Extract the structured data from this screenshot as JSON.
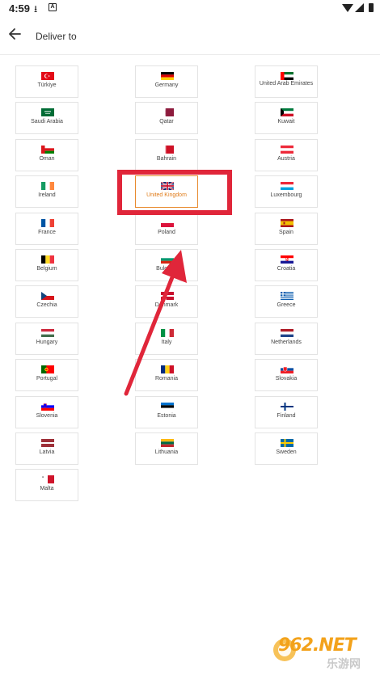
{
  "status_bar": {
    "time": "4:59"
  },
  "header": {
    "title": "Deliver to"
  },
  "countries": [
    {
      "name": "Türkiye",
      "flag": "turkey"
    },
    {
      "name": "Germany",
      "flag": "germany"
    },
    {
      "name": "United Arab Emirates",
      "flag": "uae"
    },
    {
      "name": "Saudi Arabia",
      "flag": "saudi-arabia"
    },
    {
      "name": "Qatar",
      "flag": "qatar"
    },
    {
      "name": "Kuwait",
      "flag": "kuwait"
    },
    {
      "name": "Oman",
      "flag": "oman"
    },
    {
      "name": "Bahrain",
      "flag": "bahrain"
    },
    {
      "name": "Austria",
      "flag": "austria"
    },
    {
      "name": "Ireland",
      "flag": "ireland"
    },
    {
      "name": "United Kingdom",
      "flag": "uk",
      "selected": true
    },
    {
      "name": "Luxembourg",
      "flag": "luxembourg"
    },
    {
      "name": "France",
      "flag": "france"
    },
    {
      "name": "Poland",
      "flag": "poland"
    },
    {
      "name": "Spain",
      "flag": "spain"
    },
    {
      "name": "Belgium",
      "flag": "belgium"
    },
    {
      "name": "Bulgaria",
      "flag": "bulgaria"
    },
    {
      "name": "Croatia",
      "flag": "croatia"
    },
    {
      "name": "Czechia",
      "flag": "czechia"
    },
    {
      "name": "Denmark",
      "flag": "denmark"
    },
    {
      "name": "Greece",
      "flag": "greece"
    },
    {
      "name": "Hungary",
      "flag": "hungary"
    },
    {
      "name": "Italy",
      "flag": "italy"
    },
    {
      "name": "Netherlands",
      "flag": "netherlands"
    },
    {
      "name": "Portugal",
      "flag": "portugal"
    },
    {
      "name": "Romania",
      "flag": "romania"
    },
    {
      "name": "Slovakia",
      "flag": "slovakia"
    },
    {
      "name": "Slovenia",
      "flag": "slovenia"
    },
    {
      "name": "Estonia",
      "flag": "estonia"
    },
    {
      "name": "Finland",
      "flag": "finland"
    },
    {
      "name": "Latvia",
      "flag": "latvia"
    },
    {
      "name": "Lithuania",
      "flag": "lithuania"
    },
    {
      "name": "Sweden",
      "flag": "sweden"
    },
    {
      "name": "Malta",
      "flag": "malta"
    }
  ],
  "colors": {
    "selected_accent": "#e07b18",
    "annotation_red": "#e0263a"
  },
  "watermark": {
    "text": "962.NET",
    "subtext": "乐游网"
  }
}
